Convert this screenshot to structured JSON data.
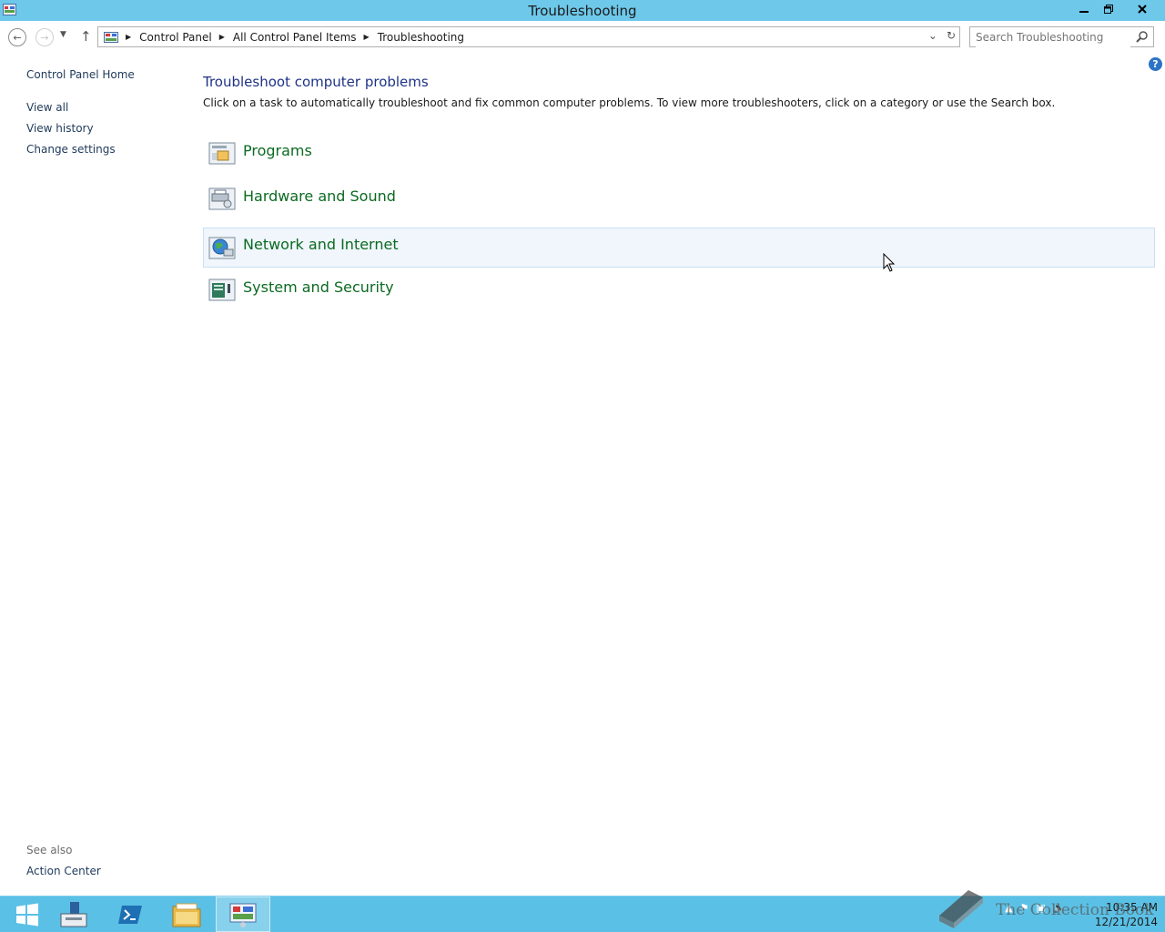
{
  "window": {
    "title": "Troubleshooting"
  },
  "address": {
    "crumbs": [
      "Control Panel",
      "All Control Panel Items",
      "Troubleshooting"
    ]
  },
  "search": {
    "placeholder": "Search Troubleshooting"
  },
  "sidebar": {
    "home": "Control Panel Home",
    "items": [
      {
        "label": "View all"
      },
      {
        "label": "View history"
      },
      {
        "label": "Change settings"
      }
    ],
    "see_also_label": "See also",
    "see_also_items": [
      {
        "label": "Action Center"
      }
    ]
  },
  "main": {
    "heading": "Troubleshoot computer problems",
    "description": "Click on a task to automatically troubleshoot and fix common computer problems. To view more troubleshooters, click on a category or use the Search box.",
    "categories": [
      {
        "label": "Programs",
        "icon": "programs-icon"
      },
      {
        "label": "Hardware and Sound",
        "icon": "hardware-sound-icon"
      },
      {
        "label": "Network and Internet",
        "icon": "network-internet-icon",
        "hovered": true
      },
      {
        "label": "System and Security",
        "icon": "system-security-icon"
      }
    ]
  },
  "taskbar": {
    "items": [
      {
        "icon": "start-icon"
      },
      {
        "icon": "server-manager-icon"
      },
      {
        "icon": "powershell-icon"
      },
      {
        "icon": "file-explorer-icon"
      },
      {
        "icon": "control-panel-icon",
        "active": true
      }
    ],
    "clock": {
      "time": "10:35 AM",
      "date": "12/21/2014"
    }
  },
  "watermark": {
    "text": "The Collection Book"
  },
  "colors": {
    "titlebar": "#6dc8ea",
    "taskbar": "#5bc0e5",
    "link_green": "#0b6a21",
    "heading_blue": "#1e3287"
  }
}
